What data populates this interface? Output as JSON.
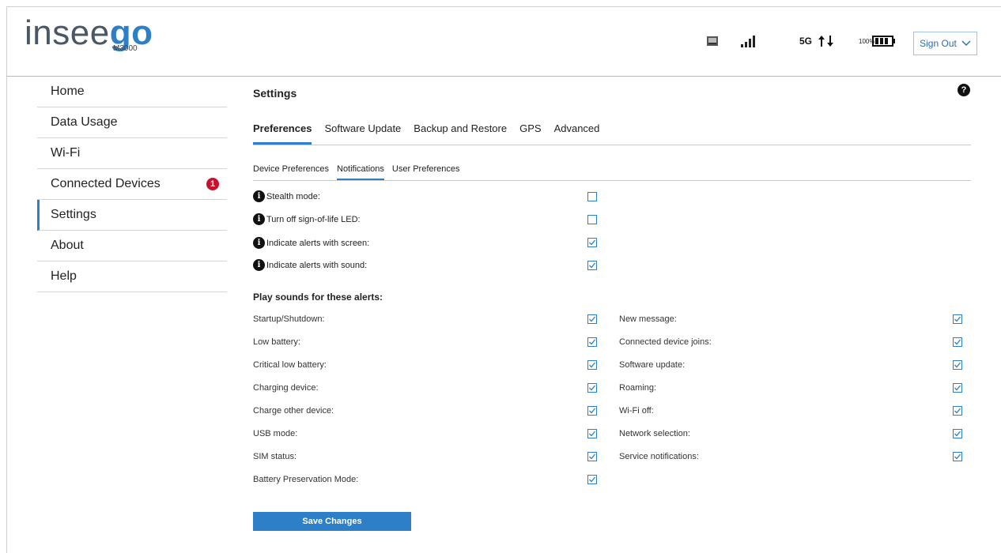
{
  "brand": {
    "word_a": "insee",
    "word_b": "go",
    "model": "M3000"
  },
  "status_bar": {
    "network": "5G",
    "battery_percent": "100%",
    "sign_out_label": "Sign Out",
    "accent": "#2d7fc8"
  },
  "sidebar": {
    "items": [
      {
        "label": "Home"
      },
      {
        "label": "Data Usage"
      },
      {
        "label": "Wi-Fi"
      },
      {
        "label": "Connected Devices",
        "badge": "1"
      },
      {
        "label": "Settings",
        "active": true
      },
      {
        "label": "About"
      },
      {
        "label": "Help"
      }
    ]
  },
  "main": {
    "title": "Settings",
    "help_glyph": "?",
    "tabs": [
      "Preferences",
      "Software Update",
      "Backup and Restore",
      "GPS",
      "Advanced"
    ],
    "subtabs": [
      "Device Preferences",
      "Notifications",
      "User Preferences"
    ],
    "preferences": [
      {
        "label": "Stealth mode:",
        "checked": false
      },
      {
        "label": "Turn off sign-of-life LED:",
        "checked": false
      },
      {
        "label": "Indicate alerts with screen:",
        "checked": true
      },
      {
        "label": "Indicate alerts with sound:",
        "checked": true
      }
    ],
    "sound_alerts_title": "Play sounds for these alerts:",
    "sound_alerts_left": [
      {
        "label": "Startup/Shutdown:",
        "checked": true
      },
      {
        "label": "Low battery:",
        "checked": true
      },
      {
        "label": "Critical low battery:",
        "checked": true
      },
      {
        "label": "Charging device:",
        "checked": true
      },
      {
        "label": "Charge other device:",
        "checked": true
      },
      {
        "label": "USB mode:",
        "checked": true
      },
      {
        "label": "SIM status:",
        "checked": true
      },
      {
        "label": "Battery Preservation Mode:",
        "checked": true
      }
    ],
    "sound_alerts_right": [
      {
        "label": "New message:",
        "checked": true
      },
      {
        "label": "Connected device joins:",
        "checked": true
      },
      {
        "label": "Software update:",
        "checked": true
      },
      {
        "label": "Roaming:",
        "checked": true
      },
      {
        "label": "Wi-Fi off:",
        "checked": true
      },
      {
        "label": "Network selection:",
        "checked": true
      },
      {
        "label": "Service notifications:",
        "checked": true
      }
    ],
    "save_label": "Save Changes"
  }
}
